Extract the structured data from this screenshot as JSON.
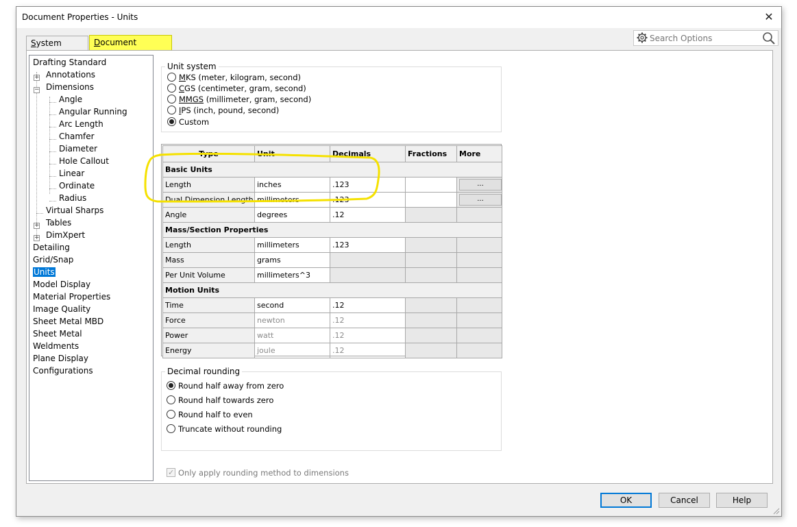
{
  "window": {
    "title": "Document Properties - Units",
    "close_glyph": "✕"
  },
  "tabs": [
    {
      "label": "System Options",
      "underline": "S",
      "rest": "ystem Options",
      "active": false
    },
    {
      "label": "Document Properties",
      "underline": "D",
      "rest": "ocument Properties",
      "active": true
    }
  ],
  "search": {
    "placeholder": "Search Options"
  },
  "tree": {
    "items": [
      {
        "label": "Drafting Standard"
      },
      {
        "label": "Annotations"
      },
      {
        "label": "Dimensions"
      },
      {
        "label": "Angle"
      },
      {
        "label": "Angular Running"
      },
      {
        "label": "Arc Length"
      },
      {
        "label": "Chamfer"
      },
      {
        "label": "Diameter"
      },
      {
        "label": "Hole Callout"
      },
      {
        "label": "Linear"
      },
      {
        "label": "Ordinate"
      },
      {
        "label": "Radius"
      },
      {
        "label": "Virtual Sharps"
      },
      {
        "label": "Tables"
      },
      {
        "label": "DimXpert"
      },
      {
        "label": "Detailing"
      },
      {
        "label": "Grid/Snap"
      },
      {
        "label": "Units"
      },
      {
        "label": "Model Display"
      },
      {
        "label": "Material Properties"
      },
      {
        "label": "Image Quality"
      },
      {
        "label": "Sheet Metal MBD"
      },
      {
        "label": "Sheet Metal"
      },
      {
        "label": "Weldments"
      },
      {
        "label": "Plane Display"
      },
      {
        "label": "Configurations"
      }
    ],
    "selected": "Units",
    "expander_plus": "+",
    "expander_minus": "−"
  },
  "unit_system": {
    "label": "Unit system",
    "options": [
      {
        "key": "M",
        "rest": "KS  (meter, kilogram, second)"
      },
      {
        "key": "C",
        "rest": "GS  (centimeter, gram, second)"
      },
      {
        "key": "MMGS",
        "rest": " (millimeter, gram, second)"
      },
      {
        "key": "I",
        "rest": "PS  (inch, pound, second)"
      },
      {
        "key": "C",
        "rest": "ustom"
      }
    ],
    "selected_index": 4
  },
  "units_table": {
    "headers": [
      "Type",
      "Unit",
      "Decimals",
      "Fractions",
      "More"
    ],
    "sections": {
      "basic": "Basic Units",
      "mass": "Mass/Section Properties",
      "motion": "Motion Units"
    },
    "basic_rows": [
      {
        "type": "Length",
        "unit": "inches",
        "decimals": ".123"
      },
      {
        "type": "Dual Dimension Length",
        "unit": "millimeters",
        "decimals": ".123"
      },
      {
        "type": "Angle",
        "unit": "degrees",
        "decimals": ".12"
      }
    ],
    "mass_rows": [
      {
        "type": "Length",
        "unit": "millimeters",
        "decimals": ".123"
      },
      {
        "type": "Mass",
        "unit": "grams",
        "decimals": ""
      },
      {
        "type": "Per Unit Volume",
        "unit": "millimeters^3",
        "decimals": ""
      }
    ],
    "motion_rows": [
      {
        "type": "Time",
        "unit": "second",
        "decimals": ".12"
      },
      {
        "type": "Force",
        "unit": "newton",
        "decimals": ".12"
      },
      {
        "type": "Power",
        "unit": "watt",
        "decimals": ".12"
      },
      {
        "type": "Energy",
        "unit": "joule",
        "decimals": ".12"
      }
    ],
    "more_label": "..."
  },
  "decimal_rounding": {
    "label": "Decimal rounding",
    "options": [
      "Round half away from zero",
      "Round half towards zero",
      "Round half to even",
      "Truncate without rounding"
    ],
    "selected_index": 0
  },
  "only_apply_checkbox": {
    "label": "Only apply rounding method to dimensions",
    "checked": true,
    "enabled": false
  },
  "buttons": {
    "ok": "OK",
    "cancel": "Cancel",
    "help": "Help"
  },
  "colors": {
    "highlight": "#ffff55",
    "selection": "#0078d7",
    "annotation": "#f5e100"
  }
}
